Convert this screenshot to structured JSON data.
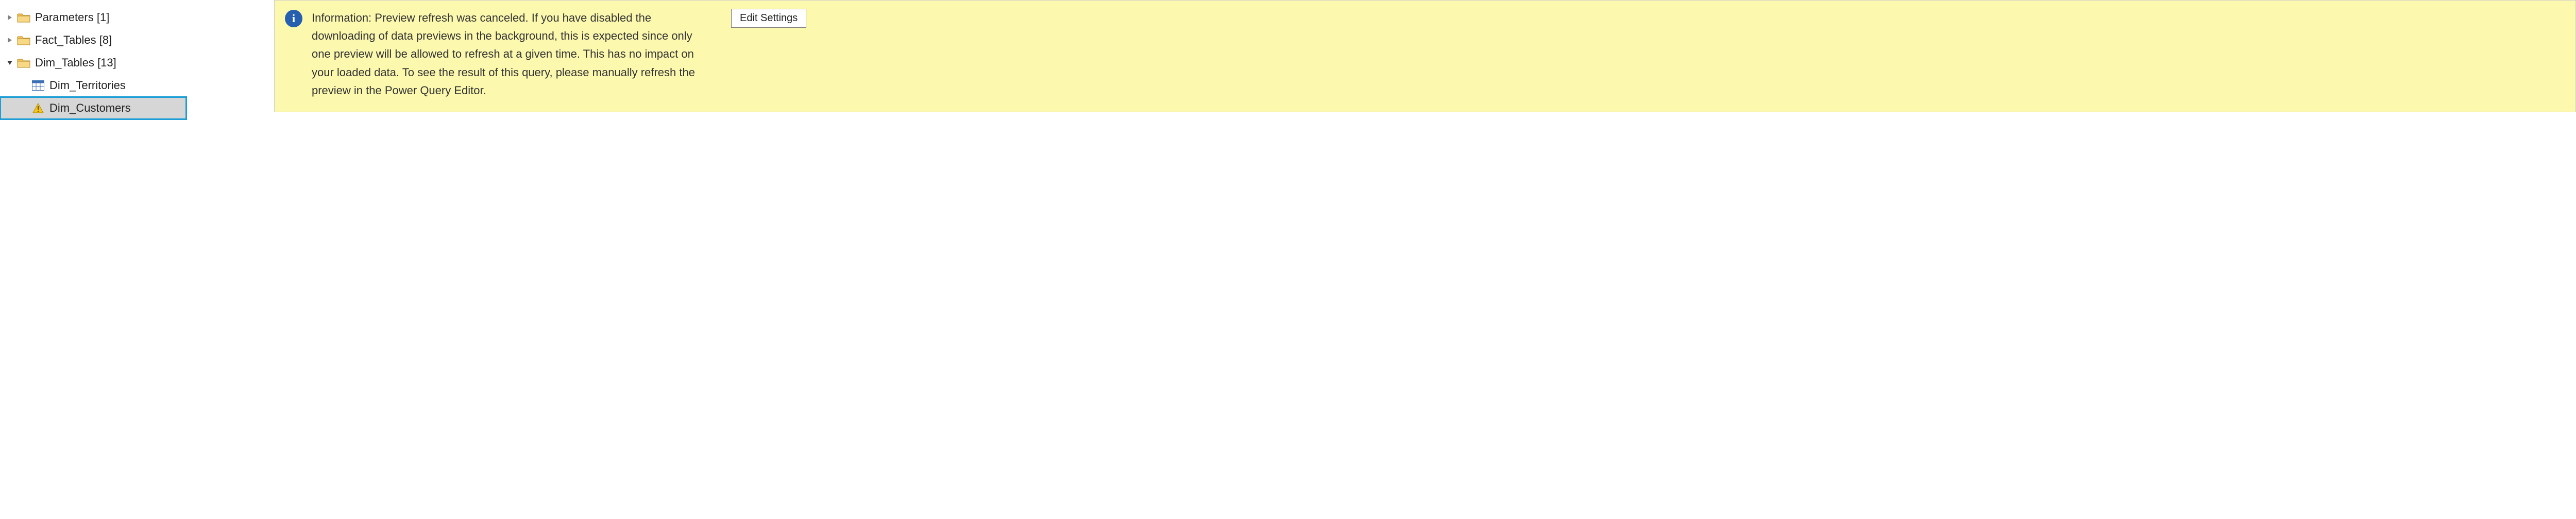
{
  "tree": {
    "folders": [
      {
        "name": "Parameters",
        "count": "[1]",
        "expanded": false
      },
      {
        "name": "Fact_Tables",
        "count": "[8]",
        "expanded": false
      },
      {
        "name": "Dim_Tables",
        "count": "[13]",
        "expanded": true
      }
    ],
    "children": [
      {
        "name": "Dim_Territories",
        "icon": "table",
        "selected": false
      },
      {
        "name": "Dim_Customers",
        "icon": "warning",
        "selected": true
      }
    ]
  },
  "info": {
    "message": "Information: Preview refresh was canceled. If you have disabled the downloading of data previews in the background, this is expected since only one preview will be allowed to refresh at a given time. This has no impact on your loaded data. To see the result of this query, please manually refresh the preview in the Power Query Editor.",
    "button": "Edit Settings"
  }
}
